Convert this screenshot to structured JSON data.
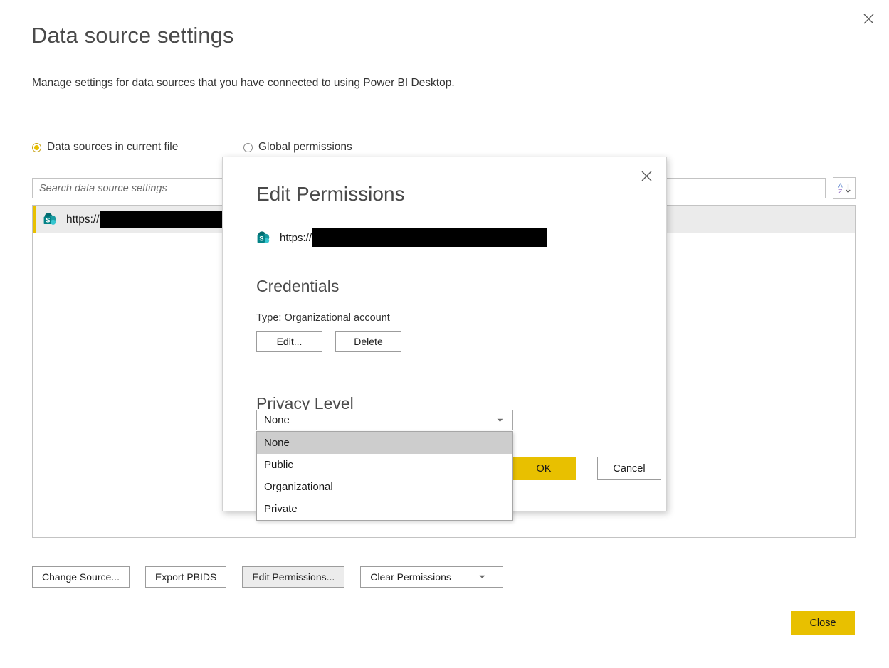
{
  "window": {
    "title": "Data source settings",
    "subtitle": "Manage settings for data sources that you have connected to using Power BI Desktop.",
    "close_icon": "close-icon"
  },
  "scope_options": [
    {
      "label": "Data sources in current file",
      "selected": true
    },
    {
      "label": "Global permissions",
      "selected": false
    }
  ],
  "search": {
    "placeholder": "Search data source settings",
    "value": "",
    "sort_icon": "sort-az-icon",
    "sort_letters": {
      "top": "A",
      "bottom": "Z"
    }
  },
  "data_sources": [
    {
      "icon": "sharepoint-icon",
      "url_prefix": "https://",
      "url_redacted": true,
      "selected": true
    }
  ],
  "toolbar": {
    "change_source": "Change Source...",
    "export_pbids": "Export PBIDS",
    "edit_permissions": "Edit Permissions...",
    "clear_permissions": "Clear Permissions",
    "clear_permissions_arrow_icon": "chevron-down-icon"
  },
  "footer": {
    "close": "Close"
  },
  "dialog": {
    "title": "Edit Permissions",
    "close_icon": "close-icon",
    "source": {
      "icon": "sharepoint-icon",
      "url_prefix": "https://",
      "url_redacted": true
    },
    "credentials": {
      "heading": "Credentials",
      "type_label": "Type: Organizational account",
      "edit": "Edit...",
      "delete": "Delete"
    },
    "privacy": {
      "heading": "Privacy Level",
      "selected": "None",
      "caret_icon": "chevron-down-icon",
      "open": true,
      "options": [
        {
          "label": "None",
          "highlighted": true
        },
        {
          "label": "Public",
          "highlighted": false
        },
        {
          "label": "Organizational",
          "highlighted": false
        },
        {
          "label": "Private",
          "highlighted": false
        }
      ]
    },
    "actions": {
      "ok": "OK",
      "cancel": "Cancel"
    }
  },
  "colors": {
    "accent_yellow": "#e8c000",
    "sharepoint_teal": "#036c70",
    "sharepoint_teal_light": "#1a9ba1",
    "selected_row_bg": "#ebebeb",
    "highlight_gray": "#cdcdcd"
  }
}
